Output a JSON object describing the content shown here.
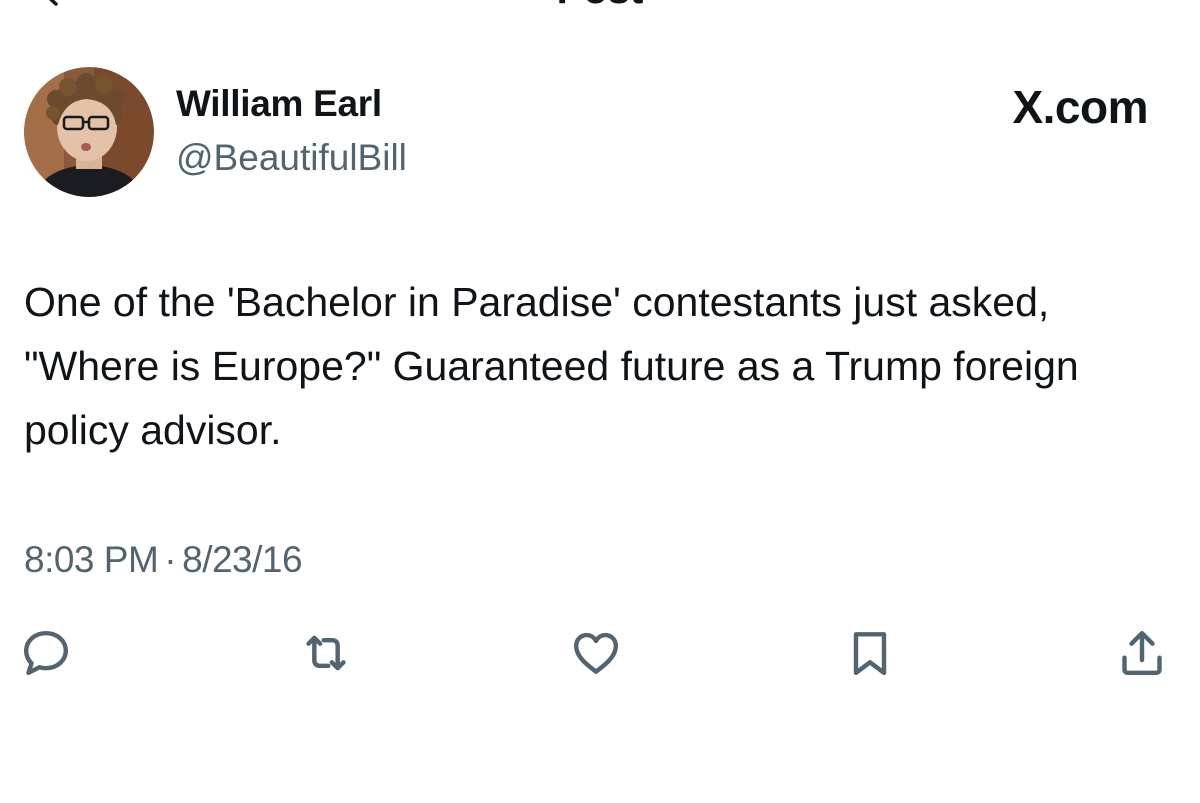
{
  "header": {
    "title": "Post",
    "back_icon": "back-arrow-icon"
  },
  "tweet": {
    "author": {
      "display_name": "William Earl",
      "handle": "@BeautifulBill"
    },
    "source": "X.com",
    "text": "One of the 'Bachelor in Paradise' contestants just asked, \"Where is Europe?\" Guaranteed future as a Trump foreign policy advisor.",
    "time": "8:03 PM",
    "separator": "·",
    "date": "8/23/16"
  },
  "actions": [
    {
      "icon": "reply-icon"
    },
    {
      "icon": "retweet-icon"
    },
    {
      "icon": "like-icon"
    },
    {
      "icon": "bookmark-icon"
    },
    {
      "icon": "share-icon"
    }
  ],
  "colors": {
    "text_primary": "#0f1419",
    "text_secondary": "#536471",
    "background": "#ffffff"
  }
}
